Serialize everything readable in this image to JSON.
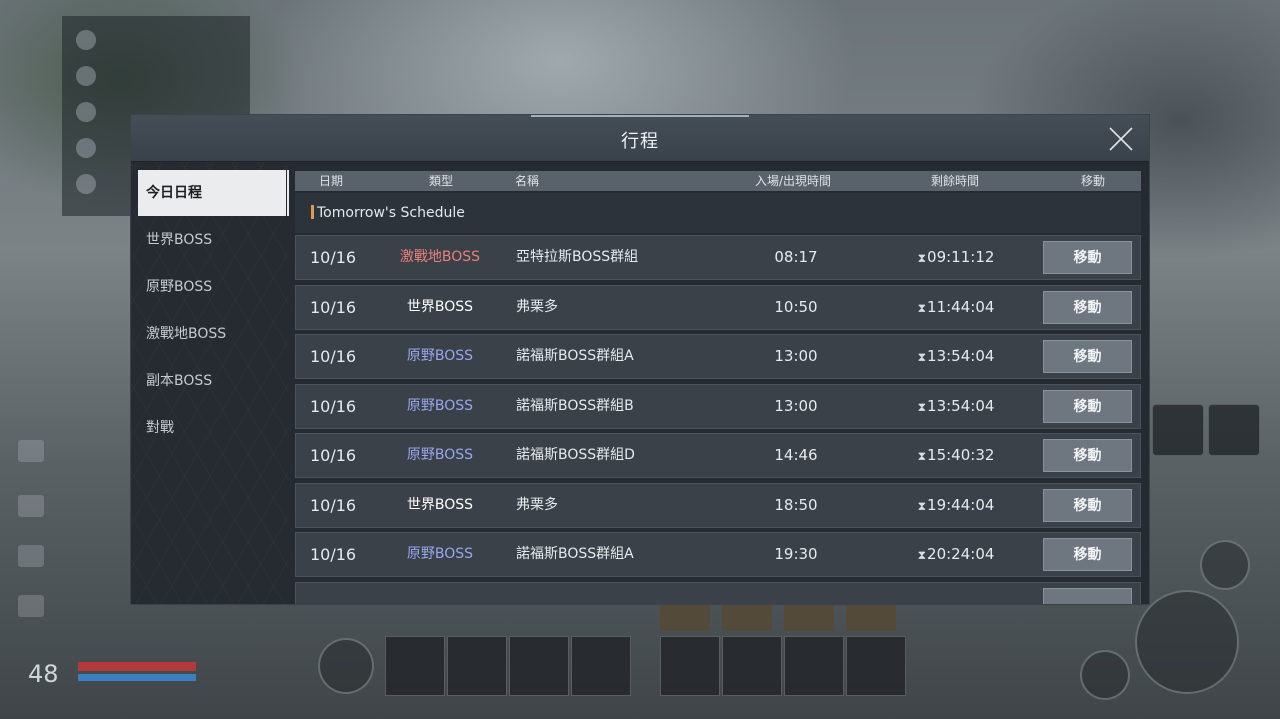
{
  "dialog": {
    "title": "行程",
    "close_icon": "close-x-icon"
  },
  "sidebar": {
    "items": [
      {
        "label": "今日日程",
        "active": true
      },
      {
        "label": "世界BOSS",
        "active": false
      },
      {
        "label": "原野BOSS",
        "active": false
      },
      {
        "label": "激戰地BOSS",
        "active": false
      },
      {
        "label": "副本BOSS",
        "active": false
      },
      {
        "label": "對戰",
        "active": false
      }
    ]
  },
  "table": {
    "headers": {
      "date": "日期",
      "type": "類型",
      "name": "名稱",
      "time": "入場/出現時間",
      "remaining": "剩餘時間",
      "move": "移動"
    },
    "section_label": "Tomorrow's Schedule",
    "type_colors": {
      "激戰地BOSS": "#e8817b",
      "世界BOSS": "#ffffff",
      "原野BOSS": "#9aa6ee"
    },
    "rows": [
      {
        "date": "10/16",
        "type": "激戰地BOSS",
        "name": "亞特拉斯BOSS群組",
        "time": "08:17",
        "remaining": "09:11:12",
        "move": "移動"
      },
      {
        "date": "10/16",
        "type": "世界BOSS",
        "name": "弗栗多",
        "time": "10:50",
        "remaining": "11:44:04",
        "move": "移動"
      },
      {
        "date": "10/16",
        "type": "原野BOSS",
        "name": "諾福斯BOSS群組A",
        "time": "13:00",
        "remaining": "13:54:04",
        "move": "移動"
      },
      {
        "date": "10/16",
        "type": "原野BOSS",
        "name": "諾福斯BOSS群組B",
        "time": "13:00",
        "remaining": "13:54:04",
        "move": "移動"
      },
      {
        "date": "10/16",
        "type": "原野BOSS",
        "name": "諾福斯BOSS群組D",
        "time": "14:46",
        "remaining": "15:40:32",
        "move": "移動"
      },
      {
        "date": "10/16",
        "type": "世界BOSS",
        "name": "弗栗多",
        "time": "18:50",
        "remaining": "19:44:04",
        "move": "移動"
      },
      {
        "date": "10/16",
        "type": "原野BOSS",
        "name": "諾福斯BOSS群組A",
        "time": "19:30",
        "remaining": "20:24:04",
        "move": "移動"
      }
    ]
  },
  "hud": {
    "level": "48"
  }
}
